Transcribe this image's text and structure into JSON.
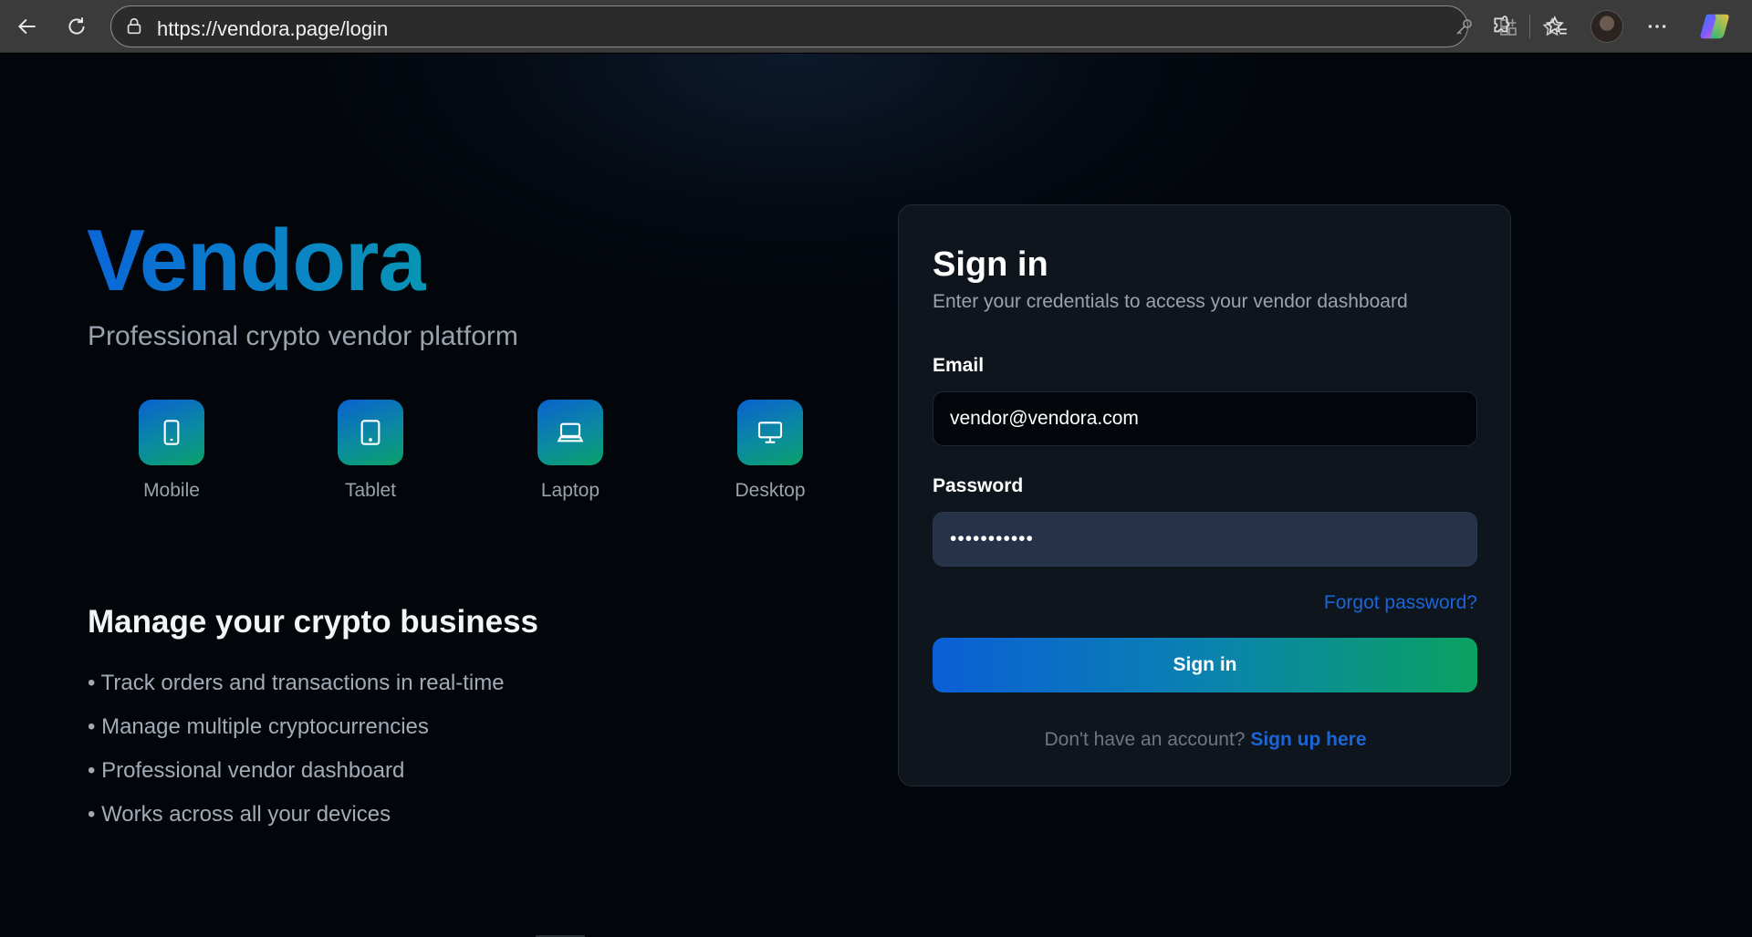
{
  "browser": {
    "url": "https://vendora.page/login",
    "icons": [
      "back-arrow-icon",
      "refresh-icon",
      "lock-icon",
      "key-icon",
      "apps-icon",
      "star-icon",
      "extensions-icon",
      "favorites-icon",
      "avatar",
      "more-icon",
      "copilot-icon"
    ]
  },
  "hero": {
    "brand": "Vendora",
    "tagline": "Professional crypto vendor platform",
    "devices": [
      {
        "label": "Mobile",
        "icon": "smartphone-icon"
      },
      {
        "label": "Tablet",
        "icon": "tablet-icon"
      },
      {
        "label": "Laptop",
        "icon": "laptop-icon"
      },
      {
        "label": "Desktop",
        "icon": "monitor-icon"
      }
    ],
    "manage_heading": "Manage your crypto business",
    "features": [
      "• Track orders and transactions in real-time",
      "• Manage multiple cryptocurrencies",
      "• Professional vendor dashboard",
      "• Works across all your devices"
    ]
  },
  "card": {
    "title": "Sign in",
    "subtitle": "Enter your credentials to access your vendor dashboard",
    "email_label": "Email",
    "email_value": "vendor@vendora.com",
    "password_label": "Password",
    "password_value": "•••••••••••",
    "forgot": "Forgot password?",
    "submit": "Sign in",
    "no_account": "Don't have an account?",
    "signup_link": "Sign up here"
  },
  "colors": {
    "accent_blue": "#0a66d8",
    "accent_green": "#0aa260",
    "link": "#1a66d9"
  }
}
